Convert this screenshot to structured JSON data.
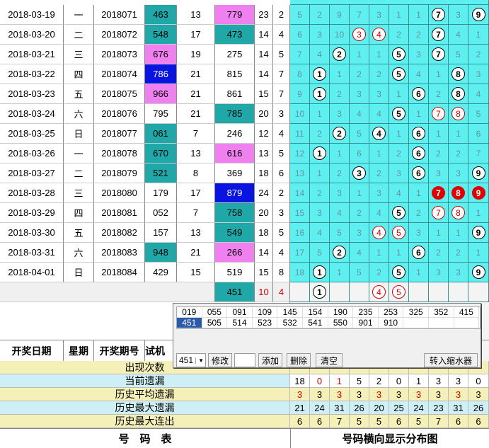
{
  "draws": [
    {
      "date": "2018-03-19",
      "weekday": "一",
      "issue": "2018071",
      "trial": "463",
      "trial_sum": "13",
      "result": "779",
      "result_sum": "23",
      "span": "2",
      "pos": [
        {
          "t": "5"
        },
        {
          "t": "2"
        },
        {
          "t": "9"
        },
        {
          "t": "7"
        },
        {
          "t": "3"
        },
        {
          "t": "1"
        },
        {
          "t": "1"
        },
        {
          "t": "7",
          "c": "b"
        },
        {
          "t": "3"
        },
        {
          "t": "9",
          "c": "b"
        }
      ]
    },
    {
      "date": "2018-03-20",
      "weekday": "二",
      "issue": "2018072",
      "trial": "548",
      "trial_sum": "17",
      "result": "473",
      "result_sum": "14",
      "span": "4",
      "pos": [
        {
          "t": "6"
        },
        {
          "t": "3"
        },
        {
          "t": "10"
        },
        {
          "t": "3",
          "c": "r"
        },
        {
          "t": "4",
          "c": "r"
        },
        {
          "t": "2"
        },
        {
          "t": "2"
        },
        {
          "t": "7",
          "c": "b"
        },
        {
          "t": "4"
        },
        {
          "t": "1"
        }
      ]
    },
    {
      "date": "2018-03-21",
      "weekday": "三",
      "issue": "2018073",
      "trial": "676",
      "trial_sum": "19",
      "result": "275",
      "result_sum": "14",
      "span": "5",
      "pos": [
        {
          "t": "7"
        },
        {
          "t": "4"
        },
        {
          "t": "2",
          "c": "b"
        },
        {
          "t": "1"
        },
        {
          "t": "1"
        },
        {
          "t": "5",
          "c": "b"
        },
        {
          "t": "3"
        },
        {
          "t": "7",
          "c": "b"
        },
        {
          "t": "5"
        },
        {
          "t": "2"
        }
      ]
    },
    {
      "date": "2018-03-22",
      "weekday": "四",
      "issue": "2018074",
      "trial": "786",
      "trial_sum": "21",
      "result": "815",
      "result_sum": "14",
      "span": "7",
      "pos": [
        {
          "t": "8"
        },
        {
          "t": "1",
          "c": "b"
        },
        {
          "t": "1"
        },
        {
          "t": "2"
        },
        {
          "t": "2"
        },
        {
          "t": "5",
          "c": "b"
        },
        {
          "t": "4"
        },
        {
          "t": "1"
        },
        {
          "t": "8",
          "c": "b"
        },
        {
          "t": "3"
        }
      ]
    },
    {
      "date": "2018-03-23",
      "weekday": "五",
      "issue": "2018075",
      "trial": "966",
      "trial_sum": "21",
      "result": "861",
      "result_sum": "15",
      "span": "7",
      "pos": [
        {
          "t": "9"
        },
        {
          "t": "1",
          "c": "b"
        },
        {
          "t": "2"
        },
        {
          "t": "3"
        },
        {
          "t": "3"
        },
        {
          "t": "1"
        },
        {
          "t": "6",
          "c": "b"
        },
        {
          "t": "2"
        },
        {
          "t": "8",
          "c": "b"
        },
        {
          "t": "4"
        }
      ]
    },
    {
      "date": "2018-03-24",
      "weekday": "六",
      "issue": "2018076",
      "trial": "795",
      "trial_sum": "21",
      "result": "785",
      "result_sum": "20",
      "span": "3",
      "pos": [
        {
          "t": "10"
        },
        {
          "t": "1"
        },
        {
          "t": "3"
        },
        {
          "t": "4"
        },
        {
          "t": "4"
        },
        {
          "t": "5",
          "c": "b"
        },
        {
          "t": "1"
        },
        {
          "t": "7",
          "c": "r"
        },
        {
          "t": "8",
          "c": "r"
        },
        {
          "t": "5"
        }
      ]
    },
    {
      "date": "2018-03-25",
      "weekday": "日",
      "issue": "2018077",
      "trial": "061",
      "trial_sum": "7",
      "result": "246",
      "result_sum": "12",
      "span": "4",
      "pos": [
        {
          "t": "11"
        },
        {
          "t": "2"
        },
        {
          "t": "2",
          "c": "b"
        },
        {
          "t": "5"
        },
        {
          "t": "4",
          "c": "b"
        },
        {
          "t": "1"
        },
        {
          "t": "6",
          "c": "b"
        },
        {
          "t": "1"
        },
        {
          "t": "1"
        },
        {
          "t": "6"
        }
      ]
    },
    {
      "date": "2018-03-26",
      "weekday": "一",
      "issue": "2018078",
      "trial": "670",
      "trial_sum": "13",
      "result": "616",
      "result_sum": "13",
      "span": "5",
      "pos": [
        {
          "t": "12"
        },
        {
          "t": "1",
          "c": "b"
        },
        {
          "t": "1"
        },
        {
          "t": "6"
        },
        {
          "t": "1"
        },
        {
          "t": "2"
        },
        {
          "t": "6",
          "c": "b"
        },
        {
          "t": "2"
        },
        {
          "t": "2"
        },
        {
          "t": "7"
        }
      ]
    },
    {
      "date": "2018-03-27",
      "weekday": "二",
      "issue": "2018079",
      "trial": "521",
      "trial_sum": "8",
      "result": "369",
      "result_sum": "18",
      "span": "6",
      "pos": [
        {
          "t": "13"
        },
        {
          "t": "1"
        },
        {
          "t": "2"
        },
        {
          "t": "3",
          "c": "b"
        },
        {
          "t": "2"
        },
        {
          "t": "3"
        },
        {
          "t": "6",
          "c": "b"
        },
        {
          "t": "3"
        },
        {
          "t": "3"
        },
        {
          "t": "9",
          "c": "b"
        }
      ]
    },
    {
      "date": "2018-03-28",
      "weekday": "三",
      "issue": "2018080",
      "trial": "179",
      "trial_sum": "17",
      "result": "879",
      "result_sum": "24",
      "span": "2",
      "pos": [
        {
          "t": "14"
        },
        {
          "t": "2"
        },
        {
          "t": "3"
        },
        {
          "t": "1"
        },
        {
          "t": "3"
        },
        {
          "t": "4"
        },
        {
          "t": "1"
        },
        {
          "t": "7",
          "c": "f"
        },
        {
          "t": "8",
          "c": "f"
        },
        {
          "t": "9",
          "c": "f"
        }
      ]
    },
    {
      "date": "2018-03-29",
      "weekday": "四",
      "issue": "2018081",
      "trial": "052",
      "trial_sum": "7",
      "result": "758",
      "result_sum": "20",
      "span": "3",
      "pos": [
        {
          "t": "15"
        },
        {
          "t": "3"
        },
        {
          "t": "4"
        },
        {
          "t": "2"
        },
        {
          "t": "4"
        },
        {
          "t": "5",
          "c": "b"
        },
        {
          "t": "2"
        },
        {
          "t": "7",
          "c": "r"
        },
        {
          "t": "8",
          "c": "r"
        },
        {
          "t": "1"
        }
      ]
    },
    {
      "date": "2018-03-30",
      "weekday": "五",
      "issue": "2018082",
      "trial": "157",
      "trial_sum": "13",
      "result": "549",
      "result_sum": "18",
      "span": "5",
      "pos": [
        {
          "t": "16"
        },
        {
          "t": "4"
        },
        {
          "t": "5"
        },
        {
          "t": "3"
        },
        {
          "t": "4",
          "c": "r"
        },
        {
          "t": "5",
          "c": "r"
        },
        {
          "t": "3"
        },
        {
          "t": "1"
        },
        {
          "t": "1"
        },
        {
          "t": "9",
          "c": "b"
        }
      ]
    },
    {
      "date": "2018-03-31",
      "weekday": "六",
      "issue": "2018083",
      "trial": "948",
      "trial_sum": "21",
      "result": "266",
      "result_sum": "14",
      "span": "4",
      "pos": [
        {
          "t": "17"
        },
        {
          "t": "5"
        },
        {
          "t": "2",
          "c": "b"
        },
        {
          "t": "4"
        },
        {
          "t": "1"
        },
        {
          "t": "1"
        },
        {
          "t": "6",
          "c": "b"
        },
        {
          "t": "2"
        },
        {
          "t": "2"
        },
        {
          "t": "1"
        }
      ]
    },
    {
      "date": "2018-04-01",
      "weekday": "日",
      "issue": "2018084",
      "trial": "429",
      "trial_sum": "15",
      "result": "519",
      "result_sum": "15",
      "span": "8",
      "pos": [
        {
          "t": "18"
        },
        {
          "t": "1",
          "c": "b"
        },
        {
          "t": "1"
        },
        {
          "t": "5"
        },
        {
          "t": "2"
        },
        {
          "t": "5",
          "c": "b"
        },
        {
          "t": "1"
        },
        {
          "t": "3"
        },
        {
          "t": "3"
        },
        {
          "t": "9",
          "c": "b"
        }
      ]
    }
  ],
  "pending": {
    "result": "451",
    "result_sum": "10",
    "span": "4",
    "pos": [
      {
        "t": ""
      },
      {
        "t": "1",
        "c": "b"
      },
      {
        "t": ""
      },
      {
        "t": ""
      },
      {
        "t": "4",
        "c": "r"
      },
      {
        "t": "5",
        "c": "r"
      },
      {
        "t": ""
      },
      {
        "t": ""
      },
      {
        "t": ""
      },
      {
        "t": ""
      }
    ]
  },
  "header": {
    "date": "开奖日期",
    "weekday": "星期",
    "issue": "开奖期号",
    "trial": "试机"
  },
  "panel": {
    "numbers": [
      [
        "019",
        "055",
        "091",
        "109",
        "145",
        "154",
        "190",
        "235",
        "253",
        "325",
        "352",
        "415"
      ],
      [
        "451",
        "505",
        "514",
        "523",
        "532",
        "541",
        "550",
        "901",
        "910",
        "",
        "",
        ""
      ]
    ],
    "selected": "451",
    "combo_value": "451",
    "buttons": {
      "modify": "修改",
      "add": "添加",
      "delete": "删除",
      "clear": "清空",
      "transfer": "转入缩水器"
    }
  },
  "stats": {
    "appear_label": "出现次数",
    "current_miss_label": "当前遗漏",
    "current_miss": [
      "18",
      "0",
      "1",
      "5",
      "2",
      "0",
      "1",
      "3",
      "3",
      "0"
    ],
    "avg_miss_label": "历史平均遗漏",
    "avg_miss": [
      "3",
      "3",
      "3",
      "3",
      "3",
      "3",
      "3",
      "3",
      "3",
      "3"
    ],
    "max_miss_label": "历史最大遗漏",
    "max_miss": [
      "21",
      "24",
      "31",
      "26",
      "20",
      "25",
      "24",
      "23",
      "31",
      "26"
    ],
    "max_run_label": "历史最大连出",
    "max_run": [
      "6",
      "6",
      "7",
      "5",
      "5",
      "6",
      "5",
      "7",
      "6",
      "6"
    ]
  },
  "footer": {
    "left": "号　码　表",
    "right": "号码横向显示分布图"
  },
  "colors": {
    "cyan": "#5ef0f0",
    "teal": "#20a8a8",
    "pink": "#f080f0",
    "blue": "#0a14e0",
    "red": "#d00000",
    "yellow": "#f4f0b8",
    "stat_bg": "#cdeff5"
  }
}
